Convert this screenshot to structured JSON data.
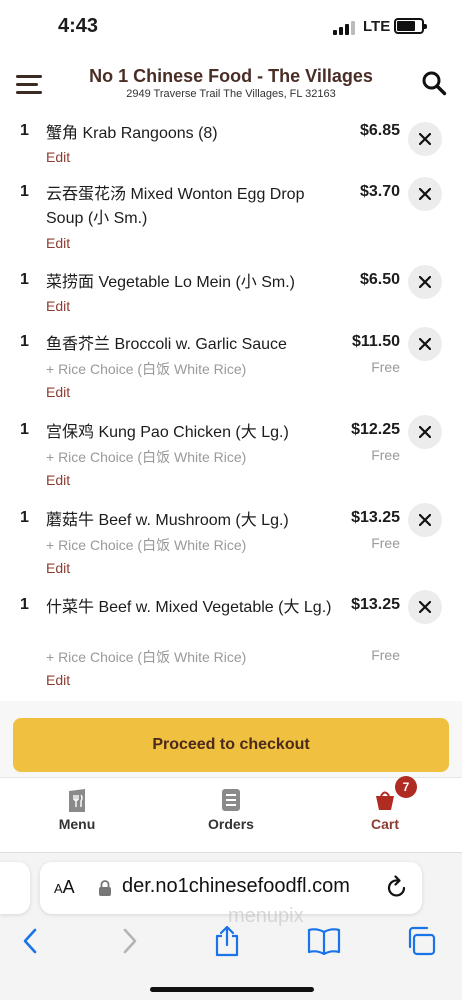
{
  "status_bar": {
    "time": "4:43",
    "network": "LTE"
  },
  "header": {
    "title": "No 1 Chinese Food - The Villages",
    "address": "2949 Traverse Trail The Villages, FL 32163"
  },
  "cart": {
    "edit_label": "Edit",
    "items": [
      {
        "qty": "1",
        "name": "蟹角 Krab Rangoons (8)",
        "price": "$6.85"
      },
      {
        "qty": "1",
        "name": "云吞蛋花汤 Mixed Wonton Egg Drop Soup (小 Sm.)",
        "price": "$3.70"
      },
      {
        "qty": "1",
        "name": "菜捞面 Vegetable Lo Mein (小 Sm.)",
        "price": "$6.50"
      },
      {
        "qty": "1",
        "name": "鱼香芥兰 Broccoli w. Garlic Sauce",
        "price": "$11.50",
        "addon": "+ Rice Choice (白饭 White Rice)",
        "addon_price": "Free"
      },
      {
        "qty": "1",
        "name": "宫保鸡 Kung Pao Chicken (大 Lg.)",
        "price": "$12.25",
        "addon": "+ Rice Choice (白饭 White Rice)",
        "addon_price": "Free"
      },
      {
        "qty": "1",
        "name": "蘑菇牛 Beef w. Mushroom (大 Lg.)",
        "price": "$13.25",
        "addon": "+ Rice Choice (白饭 White Rice)",
        "addon_price": "Free"
      },
      {
        "qty": "1",
        "name": "什菜牛 Beef w. Mixed Vegetable (大 Lg.)",
        "price": "$13.25",
        "addon": "+ Rice Choice (白饭 White Rice)",
        "addon_price": "Free"
      }
    ]
  },
  "checkout": {
    "label": "Proceed to checkout"
  },
  "bottom_nav": {
    "menu": "Menu",
    "orders": "Orders",
    "cart": "Cart",
    "cart_count": "7"
  },
  "browser": {
    "aa_small": "A",
    "aa_large": "A",
    "url": "der.no1chinesefoodfl.com",
    "watermark": "menupix"
  },
  "colors": {
    "accent": "#8b3d32",
    "checkout": "#f0c040",
    "badge": "#b02c23"
  }
}
